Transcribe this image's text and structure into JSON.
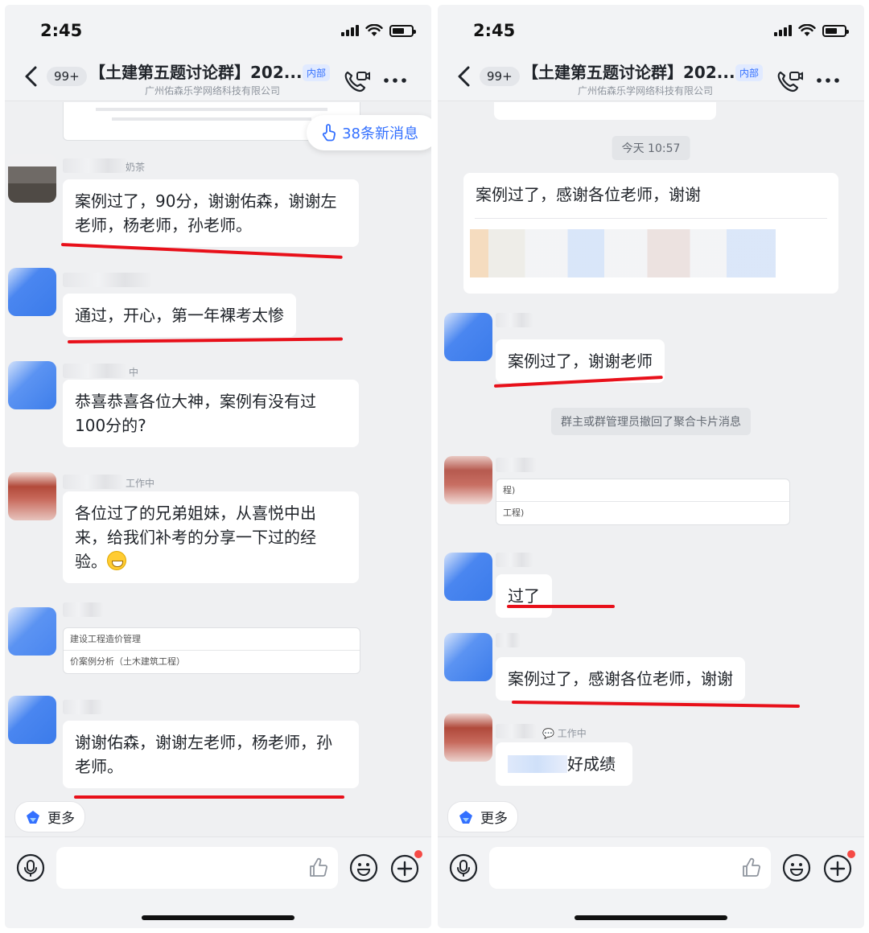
{
  "status": {
    "time": "2:45"
  },
  "header": {
    "back_badge": "99+",
    "title": "【土建第五题讨论群】202...",
    "tag": "内部",
    "subtitle": "广州佑森乐学网络科技有限公司"
  },
  "left": {
    "new_messages": "38条新消息",
    "messages": [
      {
        "sender_suffix": "奶茶",
        "text": "案例过了，90分，谢谢佑森，谢谢左老师，杨老师，孙老师。"
      },
      {
        "text": "通过，开心，第一年裸考太惨"
      },
      {
        "sender_suffix": "中",
        "text": "恭喜恭喜各位大神，案例有没有过100分的?"
      },
      {
        "sender_suffix": "工作中",
        "text": "各位过了的兄弟姐妹，从喜悦中出来，给我们补考的分享一下过的经验。"
      },
      {
        "card_rows": [
          "建设工程造价管理",
          "价案例分析（土木建筑工程）"
        ]
      },
      {
        "text": "谢谢佑森，谢谢左老师，杨老师，孙老师。"
      }
    ]
  },
  "right": {
    "time_divider": "今天 10:57",
    "messages": [
      {
        "text": "案例过了，感谢各位老师，谢谢"
      },
      {
        "text": "案例过了，谢谢老师"
      },
      {
        "system": "群主或群管理员撤回了聚合卡片消息"
      },
      {
        "card_rows": [
          "程)",
          "工程)"
        ]
      },
      {
        "text": "过了"
      },
      {
        "text": "案例过了，感谢各位老师，谢谢"
      },
      {
        "sender_suffix": "工作中",
        "text": "好成绩"
      }
    ]
  },
  "footer": {
    "more_label": "更多"
  },
  "colors": {
    "accent": "#3370ff",
    "underline": "#e8101a",
    "background": "#eff0f2"
  }
}
